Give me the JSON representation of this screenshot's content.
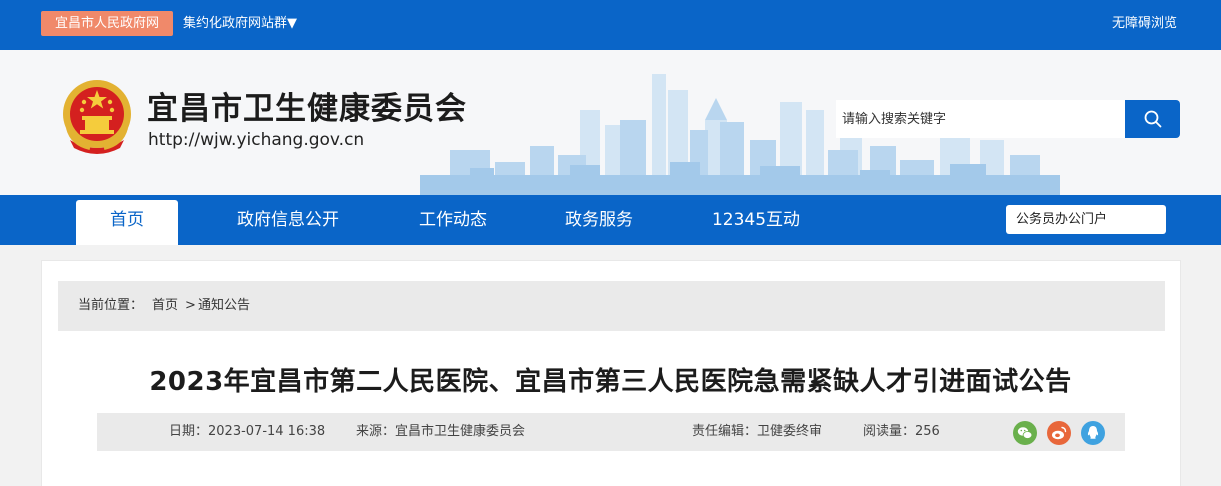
{
  "topbar": {
    "gov_link": "宜昌市人民政府网",
    "sites": "集约化政府网站群▼",
    "accessibility": "无障碍浏览"
  },
  "header": {
    "title": "宜昌市卫生健康委员会",
    "url": "http://wjw.yichang.gov.cn",
    "search_placeholder": "请输入搜索关键字"
  },
  "nav": {
    "items": [
      "首页",
      "政府信息公开",
      "工作动态",
      "政务服务",
      "12345互动"
    ],
    "portal": "公务员办公门户"
  },
  "breadcrumb": {
    "label": "当前位置：",
    "home": "首页",
    "sep": ">",
    "current": "通知公告"
  },
  "article": {
    "title": "2023年宜昌市第二人民医院、宜昌市第三人民医院急需紧缺人才引进面试公告",
    "date": "日期：2023-07-14 16:38",
    "source": "来源：宜昌市卫生健康委员会",
    "editor": "责任编辑：卫健委终审",
    "views": "阅读量：256"
  },
  "colors": {
    "brand_blue": "#0a65c8",
    "gov_link_bg": "#f0896a",
    "wechat": "#6ab04c",
    "weibo": "#e8673b",
    "qq": "#3fa2e0"
  },
  "icons": [
    "search-icon",
    "wechat-icon",
    "weibo-icon",
    "qq-icon",
    "national-emblem-icon"
  ]
}
